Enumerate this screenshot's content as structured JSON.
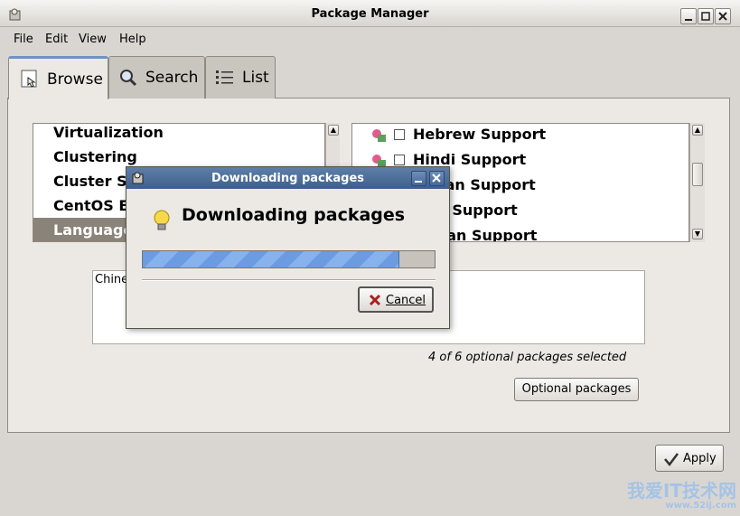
{
  "window": {
    "title": "Package Manager"
  },
  "menu": {
    "file": "File",
    "edit": "Edit",
    "view": "View",
    "help": "Help"
  },
  "tabs": [
    {
      "label": "Browse"
    },
    {
      "label": "Search"
    },
    {
      "label": "List"
    }
  ],
  "groups": {
    "items": [
      "Virtualization",
      "Clustering",
      "Cluster S",
      "CentOS E",
      "Language"
    ]
  },
  "packages": {
    "items": [
      {
        "label": "Hebrew Support",
        "checked": false
      },
      {
        "label": "Hindi Support",
        "checked": false
      },
      {
        "label": "garian Support",
        "checked": false
      },
      {
        "label": "ndic Support",
        "checked": false
      },
      {
        "label": "nesian Support",
        "checked": false
      }
    ]
  },
  "description": {
    "text": "Chine"
  },
  "status": {
    "selected_text": "4 of 6 optional packages selected"
  },
  "buttons": {
    "optional_packages": "Optional packages",
    "apply": "Apply"
  },
  "dialog": {
    "title": "Downloading packages",
    "heading": "Downloading packages",
    "progress": 0.88,
    "cancel": "Cancel"
  },
  "watermark": {
    "text": "我爱IT技术网",
    "url": "www.52ij.com"
  },
  "colors": {
    "selection": "#8a8379",
    "dialog_title": "#3d5f8b",
    "progress": "#6b9be0"
  }
}
